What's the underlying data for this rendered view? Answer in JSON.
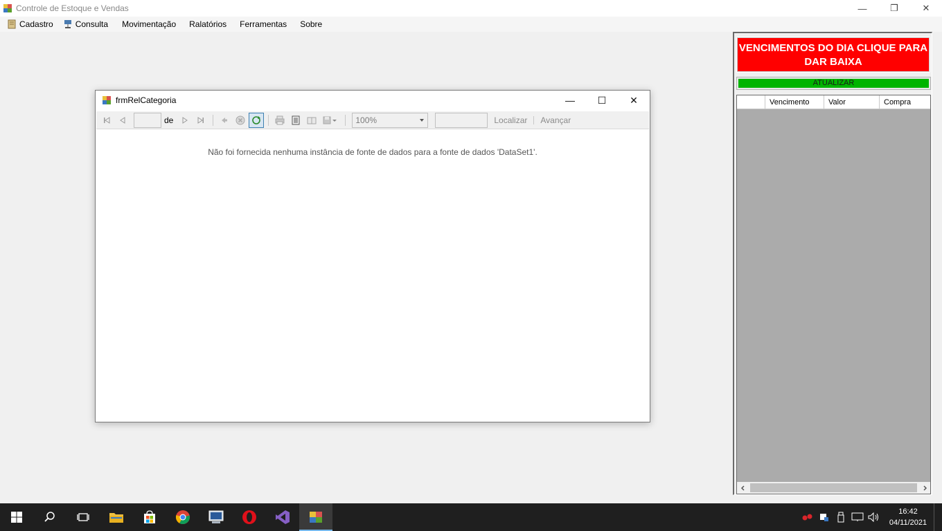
{
  "window": {
    "title": "Controle de Estoque e Vendas",
    "minimize": "—",
    "restore": "❐",
    "close": "✕"
  },
  "menu": {
    "items": [
      {
        "label": "Cadastro",
        "icon": "notebook-icon"
      },
      {
        "label": "Consulta",
        "icon": "network-icon"
      },
      {
        "label": "Movimentação"
      },
      {
        "label": "Ralatórios"
      },
      {
        "label": "Ferramentas"
      },
      {
        "label": "Sobre"
      }
    ]
  },
  "child_window": {
    "title": "frmRelCategoria",
    "minimize": "—",
    "maximize": "☐",
    "close": "✕",
    "toolbar": {
      "page_of": "de",
      "zoom": "100%",
      "find_label": "Localizar",
      "next_label": "Avançar"
    },
    "message": "Não foi fornecida nenhuma instância de fonte de dados para a fonte de dados 'DataSet1'."
  },
  "panel": {
    "venc_button": "VENCIMENTOS DO DIA CLIQUE PARA DAR BAIXA",
    "venc_color": "#ff0000",
    "update_button": "ATUALIZAR",
    "update_color": "#00b400",
    "grid_columns": [
      "",
      "Vencimento",
      "Valor",
      "Compra"
    ]
  },
  "taskbar": {
    "time": "16:42",
    "date": "04/11/2021"
  }
}
